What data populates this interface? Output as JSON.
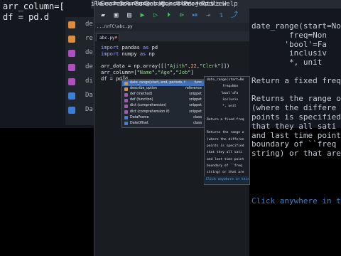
{
  "background": {
    "code_lines": [
      "arr_column=[",
      "df = pd.d"
    ],
    "menu_items": [
      "ile",
      "Search",
      "Source",
      "Run",
      "Debug",
      "Consoles",
      "Projects",
      "Tools",
      "View",
      "Help"
    ],
    "side_labels": [
      "de",
      "re",
      "de",
      "de",
      "di",
      "Da",
      "Da"
    ],
    "doc_lines": [
      "date_range(start=No",
      "        freq=Non",
      "       'bool'=Fa",
      "        inclusiv",
      "        *, unit",
      "",
      "Return a fixed frequ",
      "",
      "Returns the range o",
      "(where the differe",
      "points is specified",
      "that they all sati",
      "and last time point",
      "boundary of ``freq",
      "string) or that are"
    ],
    "doc_footer": "Click anywhere in t"
  },
  "window": {
    "menu": [
      "File",
      "Search",
      "Source",
      "Run",
      "Debug",
      "Consoles",
      "Projects",
      "Tools",
      "View",
      "Help"
    ],
    "toolbar_icons": [
      "folder-open-icon",
      "save-icon",
      "save-all-icon",
      "run-icon",
      "run-cell-icon",
      "run-cell-advance-icon",
      "run-selection-icon",
      "debug-icon",
      "step-icon",
      "step-into-icon",
      "step-return-icon"
    ],
    "path": "...nrFC\\abc.py",
    "tab": "abc.py*",
    "code": [
      {
        "parts": [
          [
            "kw",
            "import"
          ],
          [
            "t",
            " pandas "
          ],
          [
            "kw",
            "as"
          ],
          [
            "t",
            " pd"
          ]
        ]
      },
      {
        "parts": [
          [
            "kw",
            "import"
          ],
          [
            "t",
            " numpy "
          ],
          [
            "kw",
            "as"
          ],
          [
            "t",
            " np"
          ]
        ]
      },
      {
        "parts": [
          [
            "t",
            ""
          ]
        ]
      },
      {
        "parts": [
          [
            "t",
            "arr_data = np.array([[\""
          ],
          [
            "str",
            "Ajith"
          ],
          [
            "t",
            "\","
          ],
          [
            "num",
            "22"
          ],
          [
            "t",
            ",\""
          ],
          [
            "str",
            "Clerk"
          ],
          [
            "t",
            "\"]])"
          ]
        ]
      },
      {
        "parts": [
          [
            "t",
            "arr_column=[\""
          ],
          [
            "str",
            "Name"
          ],
          [
            "t",
            "\",\""
          ],
          [
            "str",
            "Age"
          ],
          [
            "t",
            "\",\""
          ],
          [
            "str",
            "Job"
          ],
          [
            "t",
            "\"]"
          ]
        ]
      },
      {
        "parts": [
          [
            "t",
            "df = pd.d"
          ]
        ]
      }
    ],
    "autocomplete": [
      {
        "name": "date_range(start, end, periods, freq, tz, normalize, name, inclusive, kwargs)",
        "type": "func",
        "icon_color": "#e08a3c",
        "selected": true
      },
      {
        "name": "describe_option",
        "type": "reference",
        "icon_color": "#e08a3c",
        "selected": false
      },
      {
        "name": "def (method)",
        "type": "snippet",
        "icon_color": "#b04fc2",
        "selected": false
      },
      {
        "name": "def (function)",
        "type": "snippet",
        "icon_color": "#b04fc2",
        "selected": false
      },
      {
        "name": "dict (comprehension)",
        "type": "snippet",
        "icon_color": "#b04fc2",
        "selected": false
      },
      {
        "name": "dict (comprehension if)",
        "type": "snippet",
        "icon_color": "#b04fc2",
        "selected": false
      },
      {
        "name": "DataFrame",
        "type": "class",
        "icon_color": "#3c7fd6",
        "selected": false
      },
      {
        "name": "DateOffset",
        "type": "class",
        "icon_color": "#3c7fd6",
        "selected": false
      }
    ],
    "doc": [
      "date_range(start=No",
      "        freq=Non",
      "       'bool'=Fa",
      "        inclusiv",
      "        *, unit",
      "",
      "Return a fixed freq",
      "",
      "Returns the range o",
      "(where the differen",
      "points is specified",
      "that they all sati",
      "and last time point",
      "boundary of ``freq",
      "string) or that are"
    ],
    "doc_footer": "Click anywhere in this tooltip"
  }
}
